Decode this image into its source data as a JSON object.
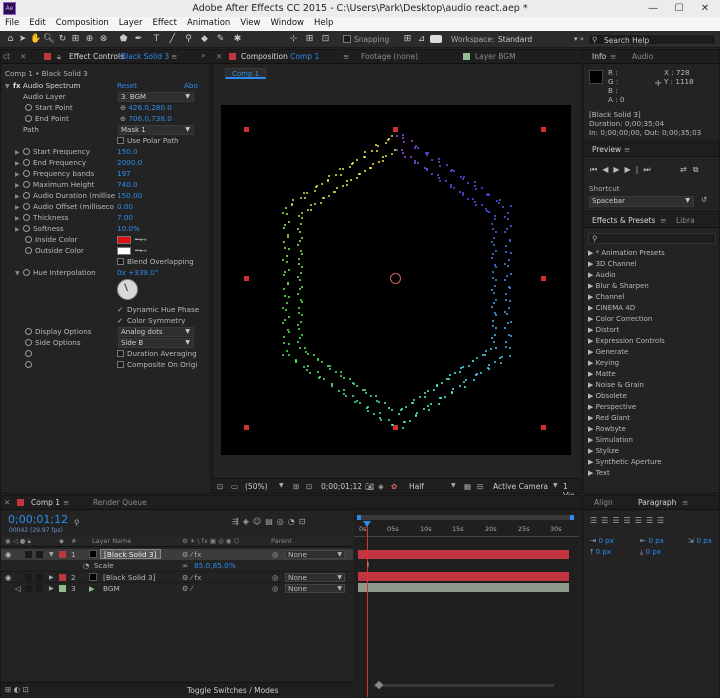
{
  "title_bar": {
    "app_icon": "Ae",
    "title": "Adobe After Effects CC 2015 - C:\\Users\\Park\\Desktop\\audio react.aep *",
    "minimize": "—",
    "maximize": "☐",
    "close": "✕"
  },
  "menu": [
    "File",
    "Edit",
    "Composition",
    "Layer",
    "Effect",
    "Animation",
    "View",
    "Window",
    "Help"
  ],
  "toolbar": {
    "snapping": "Snapping",
    "workspace_label": "Workspace:",
    "workspace_value": "Standard",
    "search_placeholder": "Search Help"
  },
  "effect_controls": {
    "tab_left": "ct",
    "tab": "Effect Controls",
    "layer": "Black Solid 3",
    "breadcrumb": "Comp 1 • Black Solid 3",
    "effect_name": "Audio Spectrum",
    "reset": "Reset",
    "about": "Abo",
    "props": [
      {
        "name": "Audio Layer",
        "value": "3. BGM",
        "kind": "dropdown"
      },
      {
        "name": "Start Point",
        "value": "426.0,280.0",
        "kind": "point"
      },
      {
        "name": "End Point",
        "value": "706.0,738.0",
        "kind": "point"
      },
      {
        "name": "Path",
        "value": "Mask 1",
        "kind": "dropdown"
      },
      {
        "name": "Use Polar Path",
        "kind": "check"
      },
      {
        "name": "Start Frequency",
        "value": "150.0",
        "kind": "num"
      },
      {
        "name": "End Frequency",
        "value": "2000.0",
        "kind": "num"
      },
      {
        "name": "Frequency bands",
        "value": "197",
        "kind": "num"
      },
      {
        "name": "Maximum Height",
        "value": "740.0",
        "kind": "num"
      },
      {
        "name": "Audio Duration (millise",
        "value": "150.00",
        "kind": "num"
      },
      {
        "name": "Audio Offset (milliseco",
        "value": "0.00",
        "kind": "num"
      },
      {
        "name": "Thickness",
        "value": "7.00",
        "kind": "num"
      },
      {
        "name": "Softness",
        "value": "10.0%",
        "kind": "num"
      },
      {
        "name": "Inside Color",
        "kind": "color"
      },
      {
        "name": "Outside Color",
        "kind": "color"
      },
      {
        "name": "Blend Overlapping",
        "kind": "check"
      },
      {
        "name": "Hue Interpolation",
        "value": "0x +339.0°",
        "kind": "angle"
      },
      {
        "name": "Dynamic Hue Phase",
        "kind": "check"
      },
      {
        "name": "Color Symmetry",
        "kind": "check"
      },
      {
        "name": "Display Options",
        "value": "Analog dots",
        "kind": "dropdown"
      },
      {
        "name": "Side Options",
        "value": "Side B",
        "kind": "dropdown"
      },
      {
        "name": "Duration Averaging",
        "kind": "check"
      },
      {
        "name": "Composite On Origi",
        "kind": "check"
      }
    ],
    "colors": {
      "inside": "#e01010",
      "outside": "#ffffff"
    }
  },
  "composition": {
    "tab": "Composition",
    "comp": "Comp 1",
    "footage": "Footage (none)",
    "layer": "Layer BGM",
    "subtab": "Comp 1",
    "zoom": "(50%)",
    "timecode": "0;00;01;12",
    "resolution": "Half",
    "camera": "Active Camera",
    "views": "1 Vie"
  },
  "info": {
    "tab": "Info",
    "tab2": "Audio",
    "r": "R :",
    "g": "G :",
    "b": "B :",
    "a": "A : 0",
    "x": "X : 728",
    "y": "Y : 1118",
    "layer": "[Black Solid 3]",
    "duration": "Duration: 0;00;35;04",
    "inout": "In: 0;00;00;00, Out: 0;00;35;03"
  },
  "preview": {
    "tab": "Preview",
    "shortcut_label": "Shortcut",
    "shortcut_value": "Spacebar"
  },
  "effects_presets": {
    "tab": "Effects & Presets",
    "tab2": "Libra",
    "items": [
      "* Animation Presets",
      "3D Channel",
      "Audio",
      "Blur & Sharpen",
      "Channel",
      "CINEMA 4D",
      "Color Correction",
      "Distort",
      "Expression Controls",
      "Generate",
      "Keying",
      "Matte",
      "Noise & Grain",
      "Obsolete",
      "Perspective",
      "Red Giant",
      "Rowbyte",
      "Simulation",
      "Stylize",
      "Synthetic Aperture",
      "Text"
    ]
  },
  "align_paragraph": {
    "tab1": "Align",
    "tab2": "Paragraph",
    "values": [
      "0 px",
      "0 px",
      "0 px",
      "0 px",
      "0 px"
    ]
  },
  "timeline": {
    "tab": "Comp 1",
    "tab2": "Render Queue",
    "timecode": "0;00;01;12",
    "fps": "00042 (29.97 fps)",
    "col_layer": "Layer Name",
    "col_parent": "Parent",
    "col_num": "#",
    "layers": [
      {
        "num": "1",
        "name": "[Black Solid 3]",
        "parent": "None",
        "label": "#c0353f"
      },
      {
        "num": "2",
        "name": "[Black Solid 3]",
        "parent": "None",
        "label": "#c0353f"
      },
      {
        "num": "3",
        "name": "BGM",
        "parent": "None",
        "label": "#8fbf8f"
      }
    ],
    "scale_label": "Scale",
    "scale_value": "85.0,85.0%",
    "ruler": [
      "0s",
      "05s",
      "10s",
      "15s",
      "20s",
      "25s",
      "30s"
    ],
    "toggle": "Toggle Switches / Modes"
  }
}
